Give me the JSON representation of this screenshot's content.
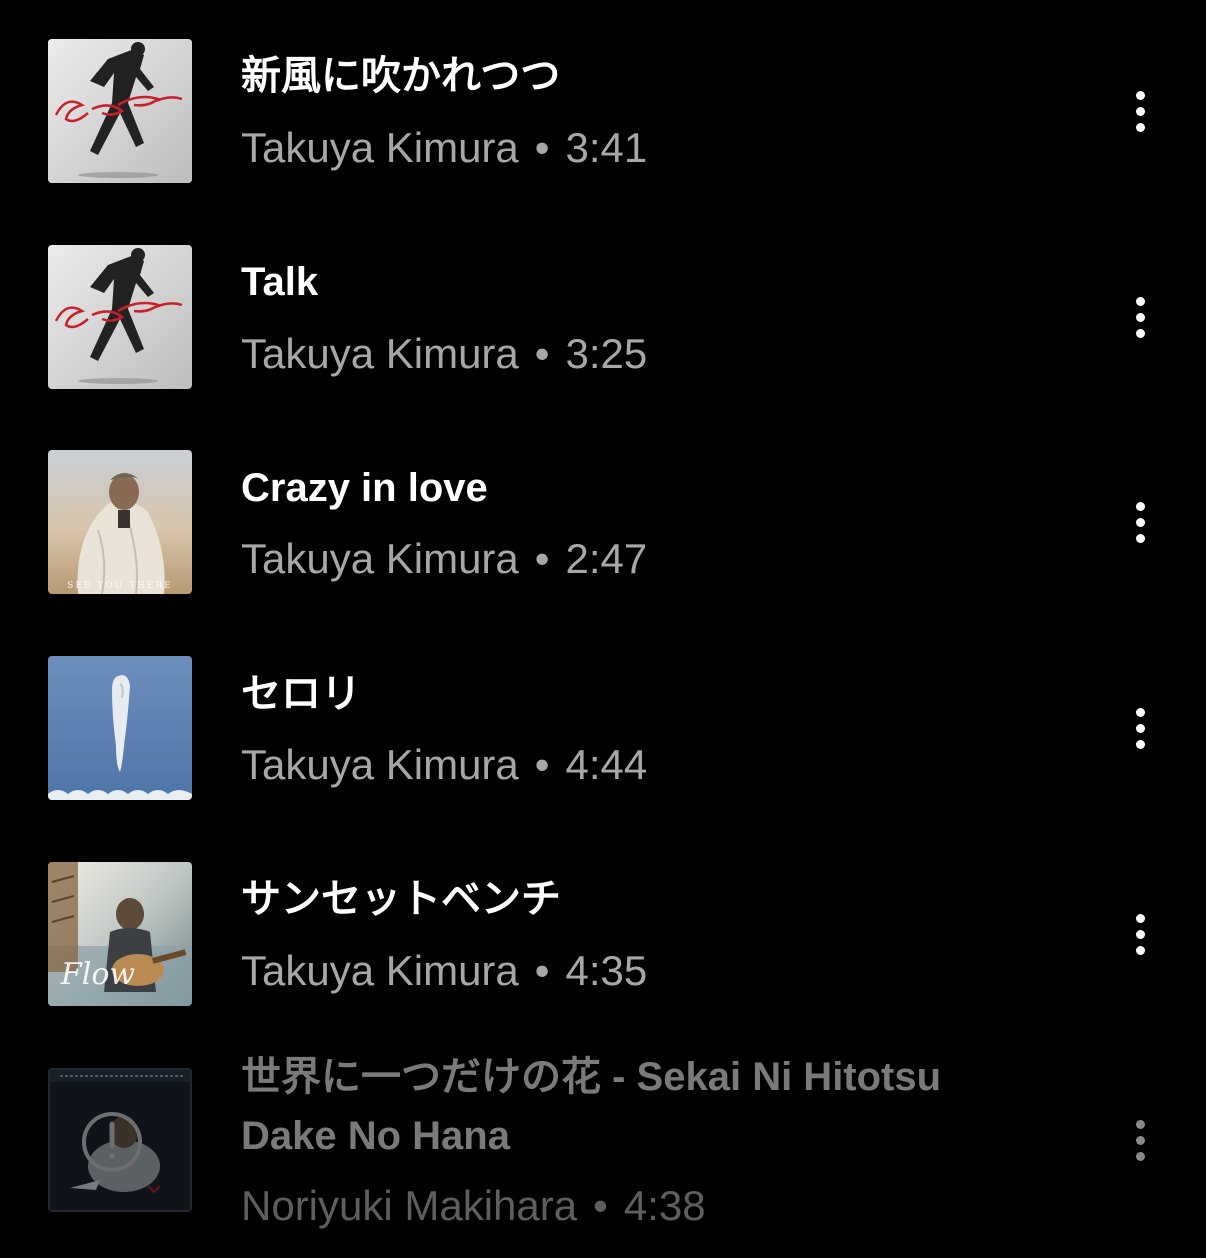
{
  "tracks": [
    {
      "title": "新風に吹かれつつ",
      "artist": "Takuya Kimura",
      "separator": "•",
      "duration": "3:41",
      "artwork": "checkpoint-album-art",
      "available": true
    },
    {
      "title": "Talk",
      "artist": "Takuya Kimura",
      "separator": "•",
      "duration": "3:25",
      "artwork": "checkpoint-album-art",
      "available": true
    },
    {
      "title": "Crazy in love",
      "artist": "Takuya Kimura",
      "separator": "•",
      "duration": "2:47",
      "artwork": "see-you-there-album-art",
      "available": true
    },
    {
      "title": "セロリ",
      "artist": "Takuya Kimura",
      "separator": "•",
      "duration": "4:44",
      "artwork": "sky-album-art",
      "available": true
    },
    {
      "title": "サンセットベンチ",
      "artist": "Takuya Kimura",
      "separator": "•",
      "duration": "4:35",
      "artwork": "flow-album-art",
      "available": true
    },
    {
      "title_line1": "世界に一つだけの花 - Sekai Ni Hitotsu",
      "title_line2": "Dake No Hana",
      "artist": "Noriyuki Makihara",
      "separator": "•",
      "duration": "4:38",
      "artwork": "makihara-album-art",
      "available": false
    }
  ],
  "icons": {
    "more": "more-vertical-icon",
    "unavailable": "unavailable-icon"
  },
  "colors": {
    "background": "#000000",
    "title": "#ffffff",
    "meta": "#a7a7a7",
    "disabled_title": "#7a7a7a",
    "disabled_meta": "#5e5e5e"
  }
}
